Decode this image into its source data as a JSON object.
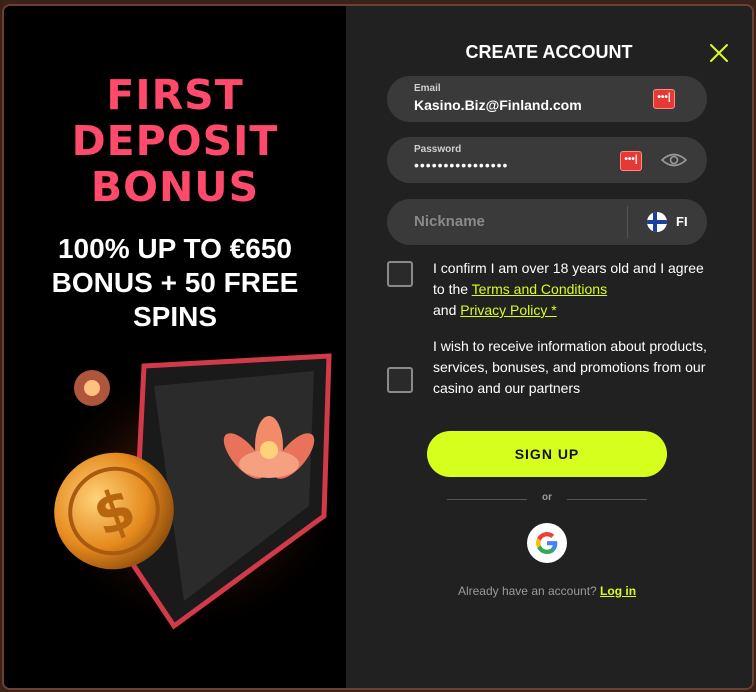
{
  "promo": {
    "title_line1": "FIRST",
    "title_line2": "DEPOSIT",
    "title_line3": "BONUS",
    "subtitle": "100% UP TO €650 BONUS + 50 FREE SPINS"
  },
  "form": {
    "title": "CREATE ACCOUNT",
    "email_label": "Email",
    "email_value": "Kasino.Biz@Finland.com",
    "password_label": "Password",
    "password_value": "••••••••••••••••",
    "nickname_placeholder": "Nickname",
    "language": "FI",
    "consent_age_prefix": "I confirm I am over 18 years old and I agree to the",
    "consent_terms_link": "Terms and Conditions",
    "consent_and": "and",
    "consent_privacy_link": "Privacy Policy *",
    "consent_marketing": "I wish to receive information about products, services, bonuses, and promotions from our casino and our partners",
    "signup_label": "SIGN UP",
    "or_text": "or",
    "already_text": "Already have an account?",
    "login_link": "Log in"
  },
  "colors": {
    "accent": "#d7ff1e",
    "promo_pink": "#ff4a6c",
    "panel": "#212121",
    "field": "#3a3a3a"
  },
  "icons": [
    "close-icon",
    "password-manager-icon",
    "eye-icon",
    "finland-flag-icon",
    "google-icon"
  ]
}
